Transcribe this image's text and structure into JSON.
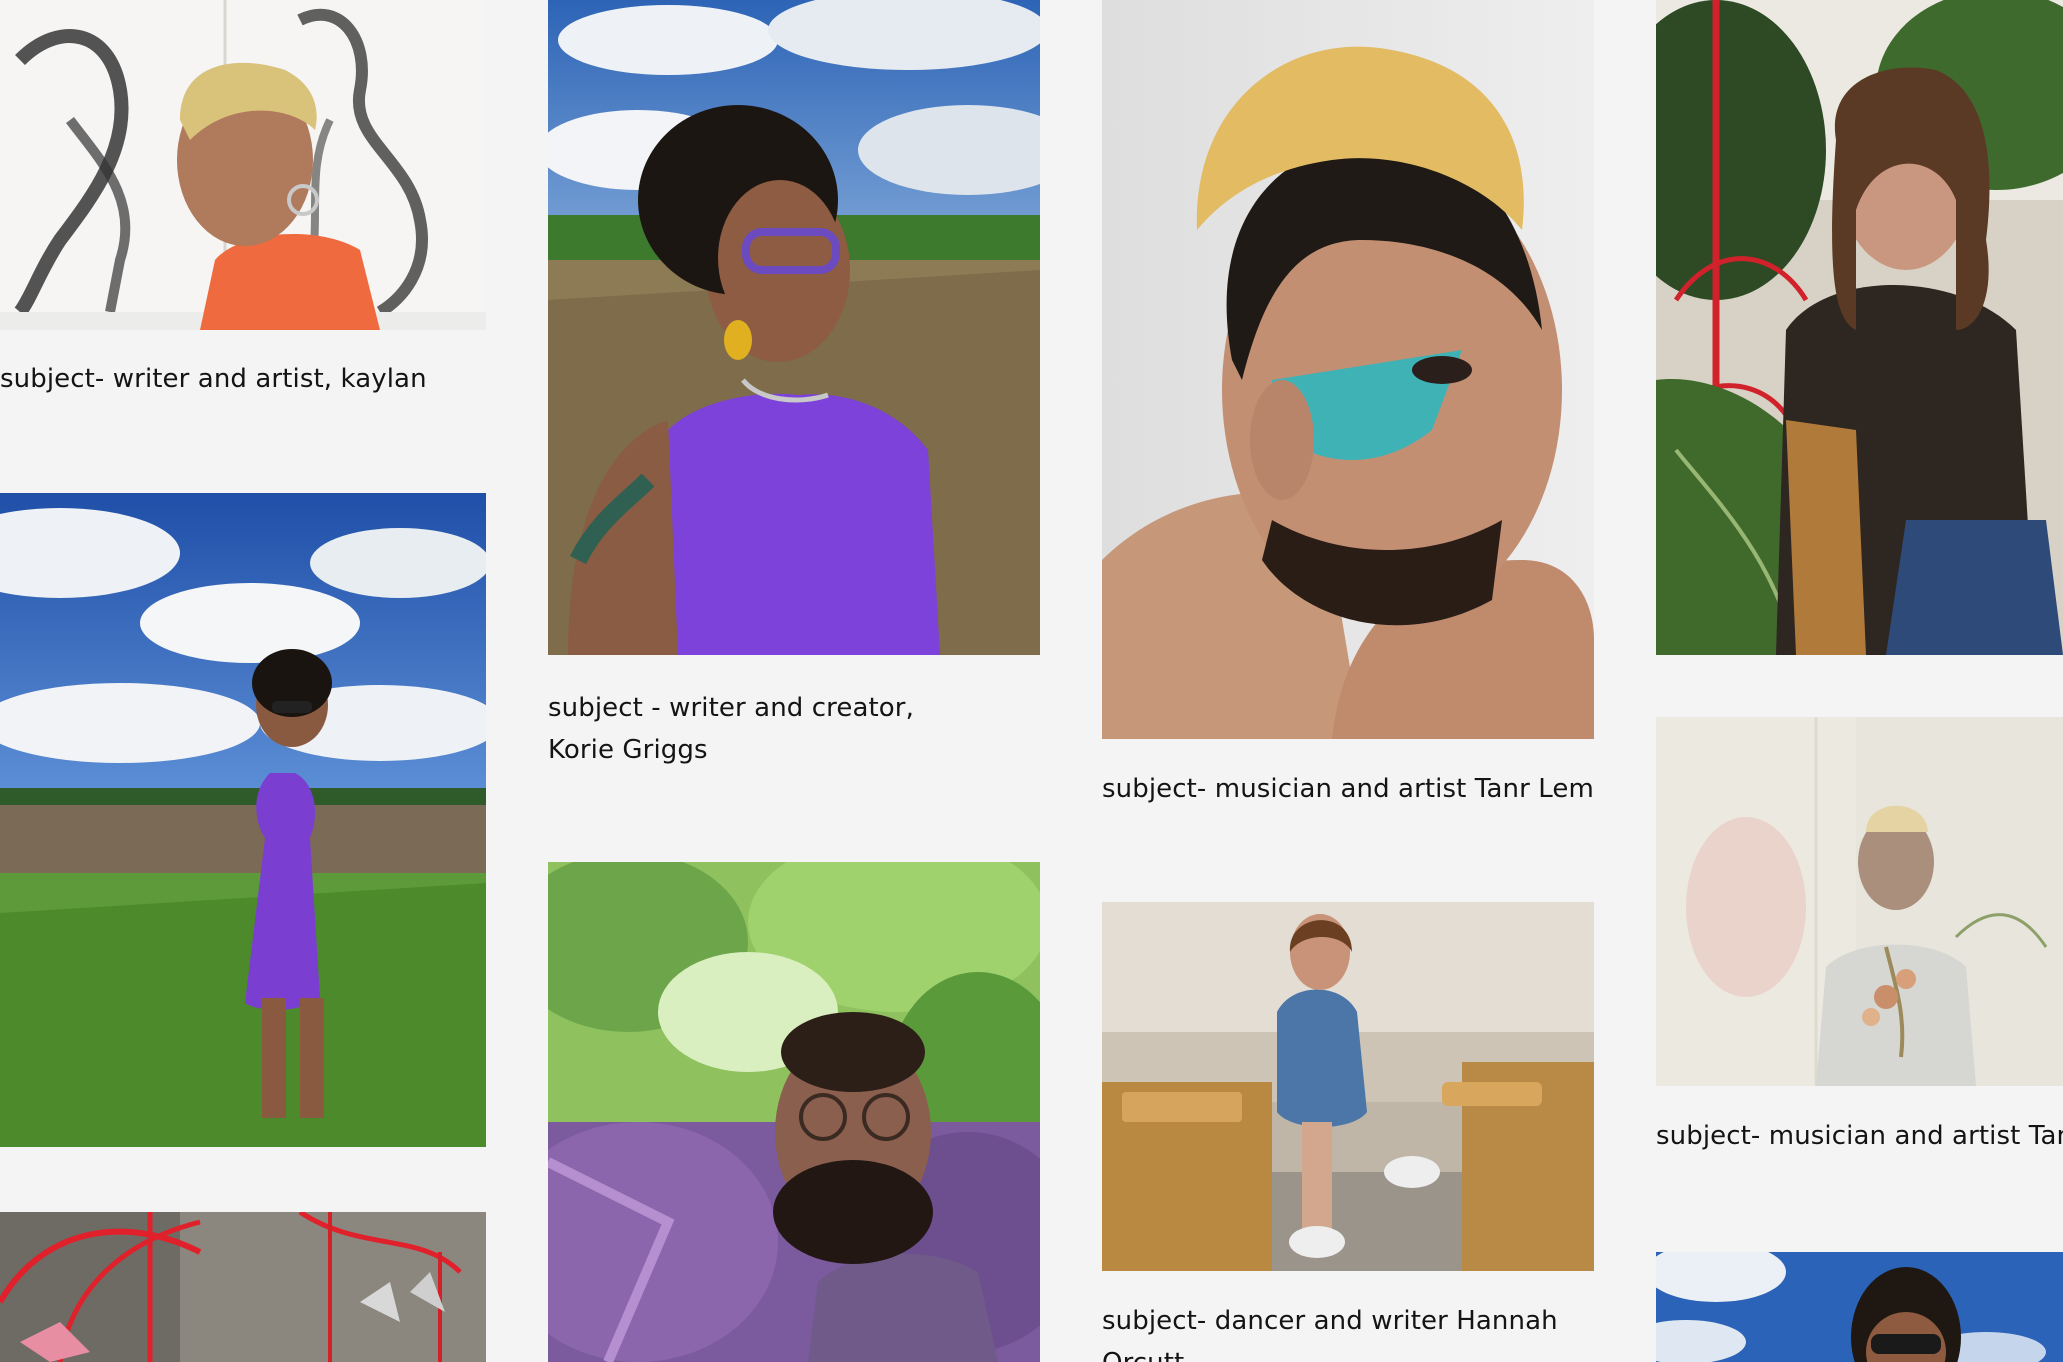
{
  "gallery": {
    "columns": [
      {
        "items": [
          {
            "caption": "subject- writer and artist, kaylan lemon",
            "image": "portrait with blonde hair, orange top and sketches behind"
          },
          {
            "caption": "",
            "image": "woman in purple dress standing in a green field under clouds"
          },
          {
            "caption": "",
            "image": "red wire hanging structure"
          }
        ]
      },
      {
        "items": [
          {
            "caption": "subject - writer and creator, Korie Griggs",
            "image": "woman with purple glasses and purple dress in a field"
          },
          {
            "caption": "",
            "image": "man with glasses looking up through green leaves"
          }
        ]
      },
      {
        "items": [
          {
            "caption": "subject- musician and artist Tanr Lemn",
            "image": "man with blonde curls and teal face paint"
          },
          {
            "caption": "subject- dancer and writer Hannah Orcutt",
            "image": "woman in denim sitting on a bench in a cafe"
          }
        ]
      },
      {
        "items": [
          {
            "caption": "",
            "image": "woman seated among potted plants"
          },
          {
            "caption": "subject- musician and artist Tanr",
            "image": "man with cap holding flowers, hazy white"
          },
          {
            "caption": "",
            "image": "woman with sunglasses under blue sky"
          }
        ]
      }
    ]
  }
}
